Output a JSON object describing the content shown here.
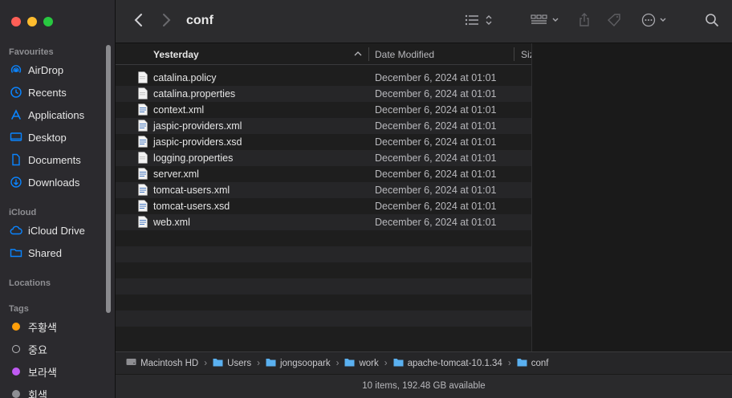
{
  "sidebar": {
    "favourites_title": "Favourites",
    "favourites": [
      {
        "label": "AirDrop",
        "icon": "airdrop-icon"
      },
      {
        "label": "Recents",
        "icon": "clock-icon"
      },
      {
        "label": "Applications",
        "icon": "applications-icon"
      },
      {
        "label": "Desktop",
        "icon": "desktop-icon"
      },
      {
        "label": "Documents",
        "icon": "document-icon"
      },
      {
        "label": "Downloads",
        "icon": "download-icon"
      }
    ],
    "icloud_title": "iCloud",
    "icloud": [
      {
        "label": "iCloud Drive",
        "icon": "cloud-icon"
      },
      {
        "label": "Shared",
        "icon": "shared-folder-icon"
      }
    ],
    "locations_title": "Locations",
    "tags_title": "Tags",
    "tags": [
      {
        "label": "주황색",
        "color": "#ff9f0a"
      },
      {
        "label": "중요",
        "color": "none"
      },
      {
        "label": "보라색",
        "color": "#bf5af2"
      },
      {
        "label": "회색",
        "color": "#8e8e93"
      }
    ]
  },
  "toolbar": {
    "title": "conf",
    "icons": [
      "back-icon",
      "forward-icon",
      "list-view-icon",
      "group-icon",
      "share-icon",
      "tag-icon",
      "more-icon",
      "search-icon"
    ]
  },
  "columns": {
    "name": "Yesterday",
    "date": "Date Modified",
    "size": "Siz"
  },
  "files": [
    {
      "name": "catalina.policy",
      "date": "December 6, 2024 at 01:01",
      "icon": "text-file-icon"
    },
    {
      "name": "catalina.properties",
      "date": "December 6, 2024 at 01:01",
      "icon": "text-file-icon"
    },
    {
      "name": "context.xml",
      "date": "December 6, 2024 at 01:01",
      "icon": "xml-file-icon"
    },
    {
      "name": "jaspic-providers.xml",
      "date": "December 6, 2024 at 01:01",
      "icon": "xml-file-icon"
    },
    {
      "name": "jaspic-providers.xsd",
      "date": "December 6, 2024 at 01:01",
      "icon": "xml-file-icon"
    },
    {
      "name": "logging.properties",
      "date": "December 6, 2024 at 01:01",
      "icon": "text-file-icon"
    },
    {
      "name": "server.xml",
      "date": "December 6, 2024 at 01:01",
      "icon": "xml-file-icon"
    },
    {
      "name": "tomcat-users.xml",
      "date": "December 6, 2024 at 01:01",
      "icon": "xml-file-icon"
    },
    {
      "name": "tomcat-users.xsd",
      "date": "December 6, 2024 at 01:01",
      "icon": "xml-file-icon"
    },
    {
      "name": "web.xml",
      "date": "December 6, 2024 at 01:01",
      "icon": "xml-file-icon"
    }
  ],
  "path": [
    "Macintosh HD",
    "Users",
    "jongsoopark",
    "work",
    "apache-tomcat-10.1.34",
    "conf"
  ],
  "status": "10 items, 192.48 GB available",
  "colors": {
    "accent": "#0a84ff",
    "folder": "#5ab0f0"
  }
}
